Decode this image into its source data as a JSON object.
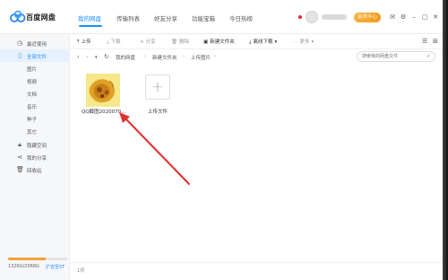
{
  "app": {
    "brand": "百度网盘",
    "nav": [
      "我的网盘",
      "传输列表",
      "好友分享",
      "功能宝箱",
      "今日热榜"
    ],
    "vip_label": "会员中心",
    "colors": {
      "accent": "#1f8fff",
      "vip": "#f5a23a",
      "storage": "#f5a23a"
    }
  },
  "sidebar": {
    "items": [
      {
        "label": "最近使用",
        "icon": "clock-icon"
      },
      {
        "label": "全部文件",
        "icon": "file-icon",
        "active": true
      },
      {
        "label": "图片"
      },
      {
        "label": "视频"
      },
      {
        "label": "文档"
      },
      {
        "label": "音乐"
      },
      {
        "label": "种子"
      },
      {
        "label": "其它"
      },
      {
        "label": "隐藏空间",
        "icon": "lock-icon"
      },
      {
        "label": "我的分享",
        "icon": "share-icon"
      },
      {
        "label": "回收站",
        "icon": "trash-icon"
      }
    ],
    "storage_text": "1326G/2068G",
    "storage_fraction": 0.64,
    "expand_label": "扩容至5T"
  },
  "toolbar": {
    "upload": "上传",
    "download": "下载",
    "share": "分享",
    "delete": "删除",
    "new_folder": "新建文件夹",
    "offline": "离线下载",
    "more": "更多"
  },
  "path": {
    "crumbs": [
      "我的网盘",
      "新建文件夹",
      "上传图片"
    ],
    "search_placeholder": "搜索我的网盘文件"
  },
  "files": [
    {
      "name": "QQ截图2020070...",
      "icon": "image-thumbnail"
    }
  ],
  "upload_tile": {
    "label": "上传文件"
  },
  "status": {
    "count_text": "1项"
  }
}
